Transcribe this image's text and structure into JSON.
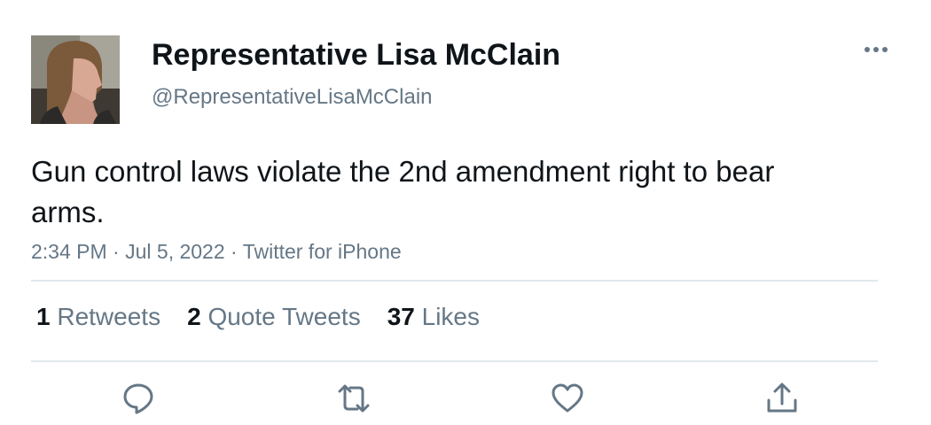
{
  "author": {
    "display_name": "Representative Lisa McClain",
    "handle": "@RepresentativeLisaMcClain"
  },
  "tweet": {
    "text": "Gun control laws violate the 2nd amendment right to bear arms.",
    "time": "2:34 PM",
    "date": "Jul 5, 2022",
    "source": "Twitter for iPhone",
    "separator": "·"
  },
  "stats": {
    "retweets": {
      "count": "1",
      "label": "Retweets"
    },
    "quote_tweets": {
      "count": "2",
      "label": "Quote Tweets"
    },
    "likes": {
      "count": "37",
      "label": "Likes"
    }
  },
  "icons": {
    "more": "more-horizontal-icon",
    "reply": "reply-icon",
    "retweet": "retweet-icon",
    "like": "heart-icon",
    "share": "share-icon"
  },
  "colors": {
    "text": "#0f1419",
    "secondary": "#657786",
    "divider": "#e1e8ed"
  }
}
